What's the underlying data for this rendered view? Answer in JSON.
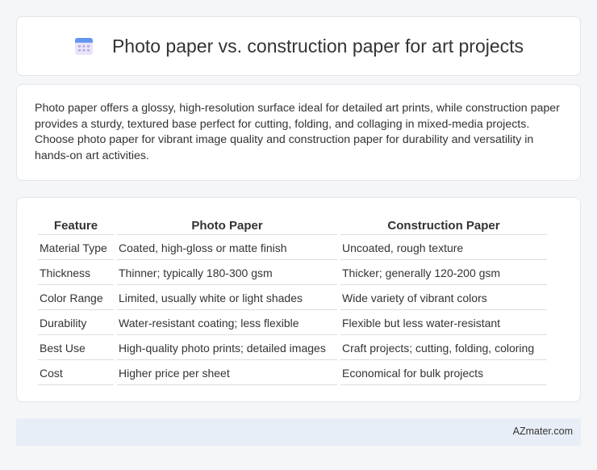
{
  "header": {
    "title": "Photo paper vs. construction paper for art projects",
    "icon": "calendar-icon"
  },
  "summary": {
    "text": "Photo paper offers a glossy, high-resolution surface ideal for detailed art prints, while construction paper provides a sturdy, textured base perfect for cutting, folding, and collaging in mixed-media projects. Choose photo paper for vibrant image quality and construction paper for durability and versatility in hands-on art activities."
  },
  "table": {
    "headers": [
      "Feature",
      "Photo Paper",
      "Construction Paper"
    ],
    "rows": [
      [
        "Material Type",
        "Coated, high-gloss or matte finish",
        "Uncoated, rough texture"
      ],
      [
        "Thickness",
        "Thinner; typically 180-300 gsm",
        "Thicker; generally 120-200 gsm"
      ],
      [
        "Color Range",
        "Limited, usually white or light shades",
        "Wide variety of vibrant colors"
      ],
      [
        "Durability",
        "Water-resistant coating; less flexible",
        "Flexible but less water-resistant"
      ],
      [
        "Best Use",
        "High-quality photo prints; detailed images",
        "Craft projects; cutting, folding, coloring"
      ],
      [
        "Cost",
        "Higher price per sheet",
        "Economical for bulk projects"
      ]
    ]
  },
  "footer": {
    "brand": "AZmater.com"
  },
  "colors": {
    "background": "#f5f6f8",
    "footer_bg": "#e8eef7",
    "icon_accent": "#4a7fe0"
  }
}
